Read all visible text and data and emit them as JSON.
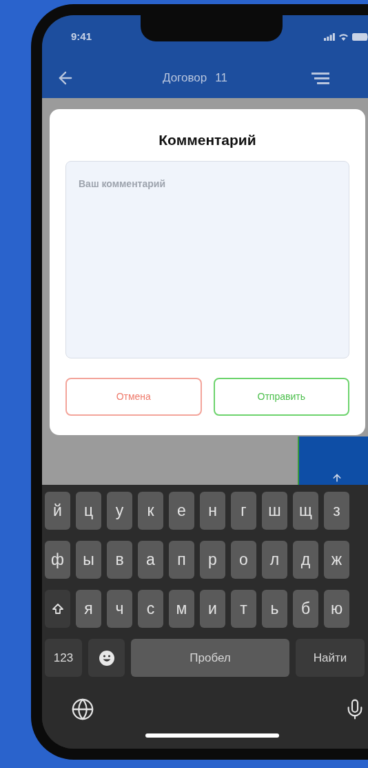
{
  "status_bar": {
    "time": "9:41"
  },
  "nav": {
    "title": "Договор",
    "number": "11"
  },
  "dialog": {
    "title": "Комментарий",
    "comment": {
      "placeholder": "Ваш комментарий"
    },
    "buttons": [
      {
        "label": "Отмена",
        "kind": "cancel"
      },
      {
        "label": "Отправить",
        "kind": "submit"
      }
    ]
  },
  "keyboard": {
    "rows": [
      {
        "keys": [
          "й",
          "ц",
          "у",
          "к",
          "е",
          "н",
          "г",
          "ш",
          "щ",
          "з"
        ]
      },
      {
        "keys": [
          "ф",
          "ы",
          "в",
          "а",
          "п",
          "р",
          "о",
          "л",
          "д",
          "ж"
        ]
      },
      {
        "keys": [
          {
            "kind": "shift"
          },
          "я",
          "ч",
          "с",
          "м",
          "и",
          "т",
          "ь",
          "б",
          "ю"
        ]
      }
    ],
    "bottom": [
      {
        "kind": "mode",
        "label": "123"
      },
      {
        "kind": "emoji"
      },
      {
        "kind": "space",
        "label": "Пробел"
      },
      {
        "kind": "action",
        "label": "Найти"
      }
    ]
  }
}
